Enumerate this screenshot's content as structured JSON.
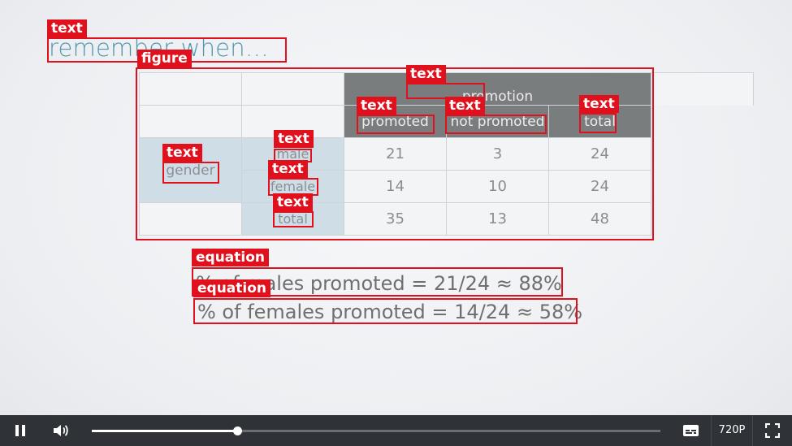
{
  "slide": {
    "title": "remember when…",
    "table": {
      "header_group": "promotion",
      "col_headers": [
        "promoted",
        "not promoted",
        "total"
      ],
      "row_group": "gender",
      "rows": [
        {
          "label": "male",
          "values": [
            "21",
            "3",
            "24"
          ]
        },
        {
          "label": "female",
          "values": [
            "14",
            "10",
            "24"
          ]
        },
        {
          "label": "total",
          "values": [
            "35",
            "13",
            "48"
          ]
        }
      ]
    },
    "equations": [
      "% of males promoted = 21/24 ≈ 88%",
      "% of females promoted = 14/24 ≈ 58%"
    ]
  },
  "annotations": {
    "text": "text",
    "figure": "figure",
    "equation": "equation",
    "color": "#e0101c"
  },
  "player": {
    "play_state_icon": "pause-icon",
    "volume_icon": "volume-icon",
    "progress": 0.255,
    "captions_icon": "captions-icon",
    "quality": "720P",
    "fullscreen_icon": "fullscreen-icon"
  }
}
